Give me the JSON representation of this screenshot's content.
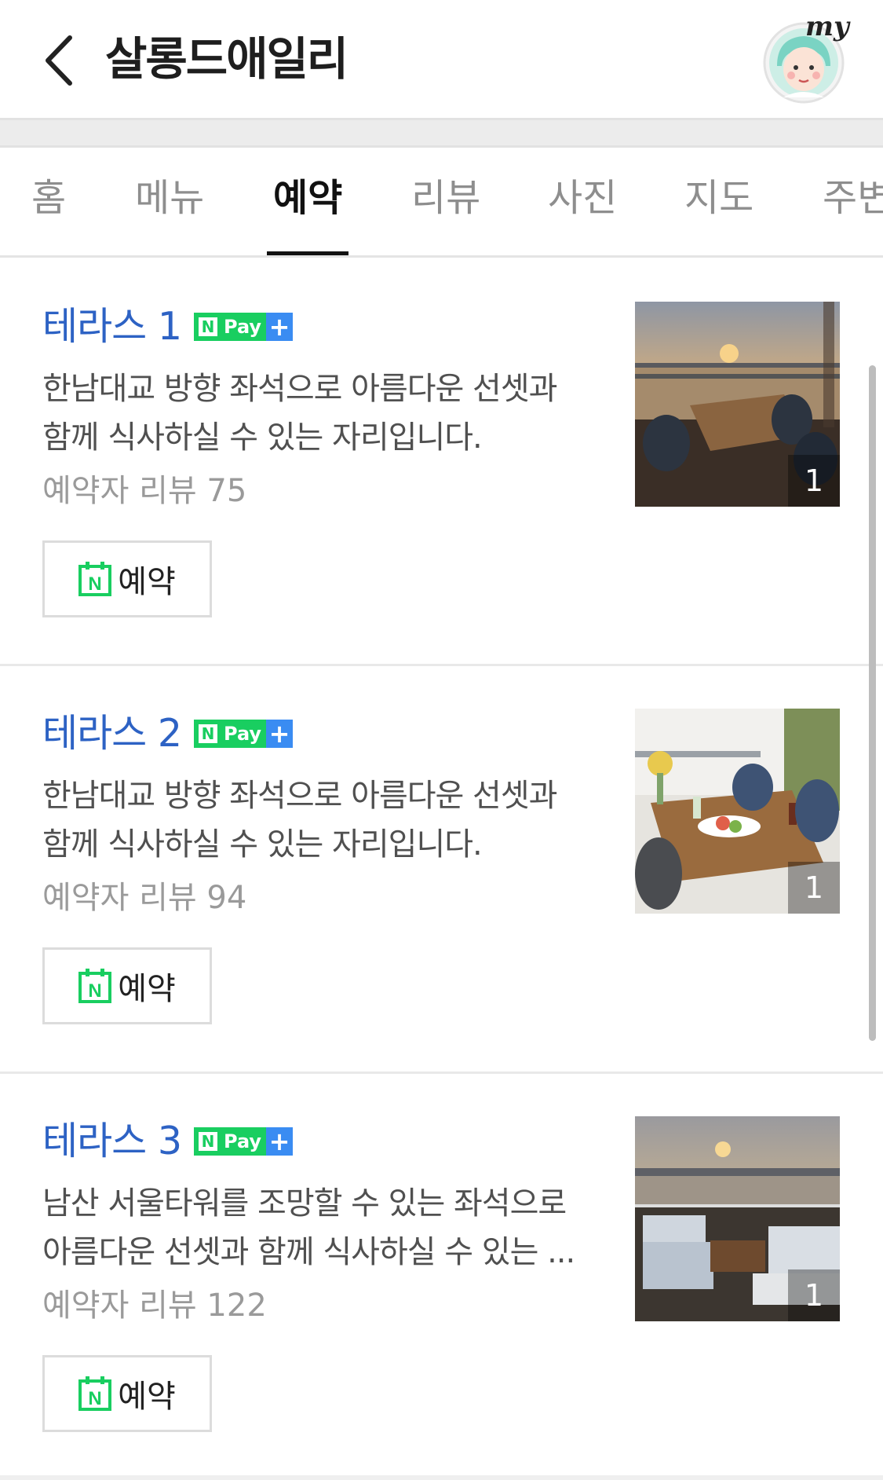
{
  "header": {
    "title": "살롱드애일리",
    "my_label": "my"
  },
  "tabs": [
    {
      "label": "홈"
    },
    {
      "label": "메뉴"
    },
    {
      "label": "예약",
      "active": true
    },
    {
      "label": "리뷰"
    },
    {
      "label": "사진"
    },
    {
      "label": "지도"
    },
    {
      "label": "주변"
    }
  ],
  "npay": {
    "n": "N",
    "pay": "Pay",
    "plus": "+"
  },
  "items": [
    {
      "title": "테라스 1",
      "desc_lines": [
        "한남대교 방향 좌석으로 아름다운 선셋과",
        "함께 식사하실 수 있는 자리입니다."
      ],
      "review": "예약자 리뷰 75",
      "button": "예약",
      "photo_count": "1"
    },
    {
      "title": "테라스 2",
      "desc_lines": [
        "한남대교 방향 좌석으로 아름다운 선셋과",
        "함께 식사하실 수 있는 자리입니다."
      ],
      "review": "예약자 리뷰 94",
      "button": "예약",
      "photo_count": "1"
    },
    {
      "title": "테라스 3",
      "desc_lines": [
        "남산 서울타워를 조망할 수 있는 좌석으로",
        "아름다운 선셋과 함께 식사하실 수 있는 ..."
      ],
      "review": "예약자 리뷰 122",
      "button": "예약",
      "photo_count": "1"
    }
  ],
  "colors": {
    "title_blue": "#2d62c4",
    "naver_green": "#19ce60",
    "pay_blue": "#3a8cf2"
  }
}
